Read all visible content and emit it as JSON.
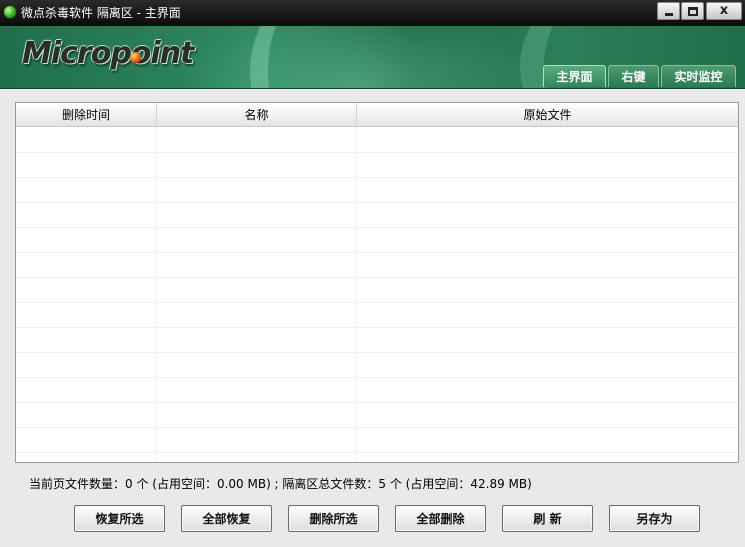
{
  "window": {
    "title": "微点杀毒软件 隔离区 - 主界面",
    "close_glyph": "x",
    "icons": {
      "app": "app-icon",
      "minimize": "minimize-icon",
      "maximize": "maximize-icon",
      "close": "close-icon"
    }
  },
  "banner": {
    "logo_text": "Micropoint",
    "tabs": [
      {
        "label": "主界面",
        "active": true
      },
      {
        "label": "右键",
        "active": false
      },
      {
        "label": "实时监控",
        "active": false
      }
    ]
  },
  "list": {
    "columns": [
      "删除时间",
      "名称",
      "原始文件"
    ],
    "rows": []
  },
  "status": {
    "text": "当前页文件数量：0 个 (占用空间：0.00 MB) ; 隔离区总文件数：5 个 (占用空间：42.89 MB)"
  },
  "actions": {
    "restore_selected": "恢复所选",
    "restore_all": "全部恢复",
    "delete_selected": "删除所选",
    "delete_all": "全部删除",
    "refresh": "刷  新",
    "save_as": "另存为"
  },
  "colors": {
    "banner_green": "#2f8a60",
    "titlebar": "#0a0a0a",
    "accent_orange": "#e0560a"
  }
}
